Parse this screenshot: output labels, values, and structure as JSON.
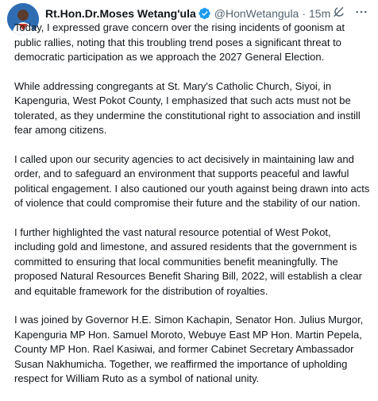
{
  "tweet": {
    "author_name": "Rt.Hon.Dr.Moses Wetang'ula",
    "handle": "@HonWetangula",
    "separator": "·",
    "time": "15m",
    "paragraphs": [
      "Today, I expressed grave concern over the rising incidents of goonism at public rallies, noting that this troubling trend poses a significant threat to democratic participation as we approach the 2027 General Election.",
      "While addressing congregants at St. Mary's Catholic Church, Siyoi, in Kapenguria, West Pokot County, I emphasized that such acts must not be tolerated, as they undermine the constitutional right to association and instill fear among citizens.",
      "I called upon our security agencies to act decisively in maintaining law and order, and to safeguard an environment that supports peaceful and lawful political engagement. I also cautioned our youth against being drawn into acts of violence that could compromise their future and the stability of our nation.",
      "I further highlighted the vast natural resource potential of West Pokot, including gold and limestone, and assured residents that the government is committed to ensuring that local communities benefit meaningfully. The proposed Natural Resources Benefit Sharing Bill, 2022, will establish a clear and equitable framework for the distribution of royalties.",
      "I was joined by Governor H.E. Simon Kachapin, Senator Hon. Julius Murgor, Kapenguria MP Hon. Samuel Moroto, Webuye East MP Hon. Martin Pepela, County MP Hon. Rael Kasiwai, and former Cabinet Secretary Ambassador Susan Nakhumicha. Together, we reaffirmed the importance of upholding respect for William Ruto as a symbol of national unity."
    ]
  },
  "icons": {
    "verified": "verified-badge-icon",
    "grok": "grok-icon",
    "more": "more-options-icon"
  },
  "colors": {
    "text": "#0f1419",
    "secondary": "#536471",
    "verified_blue": "#1d9bf0"
  }
}
